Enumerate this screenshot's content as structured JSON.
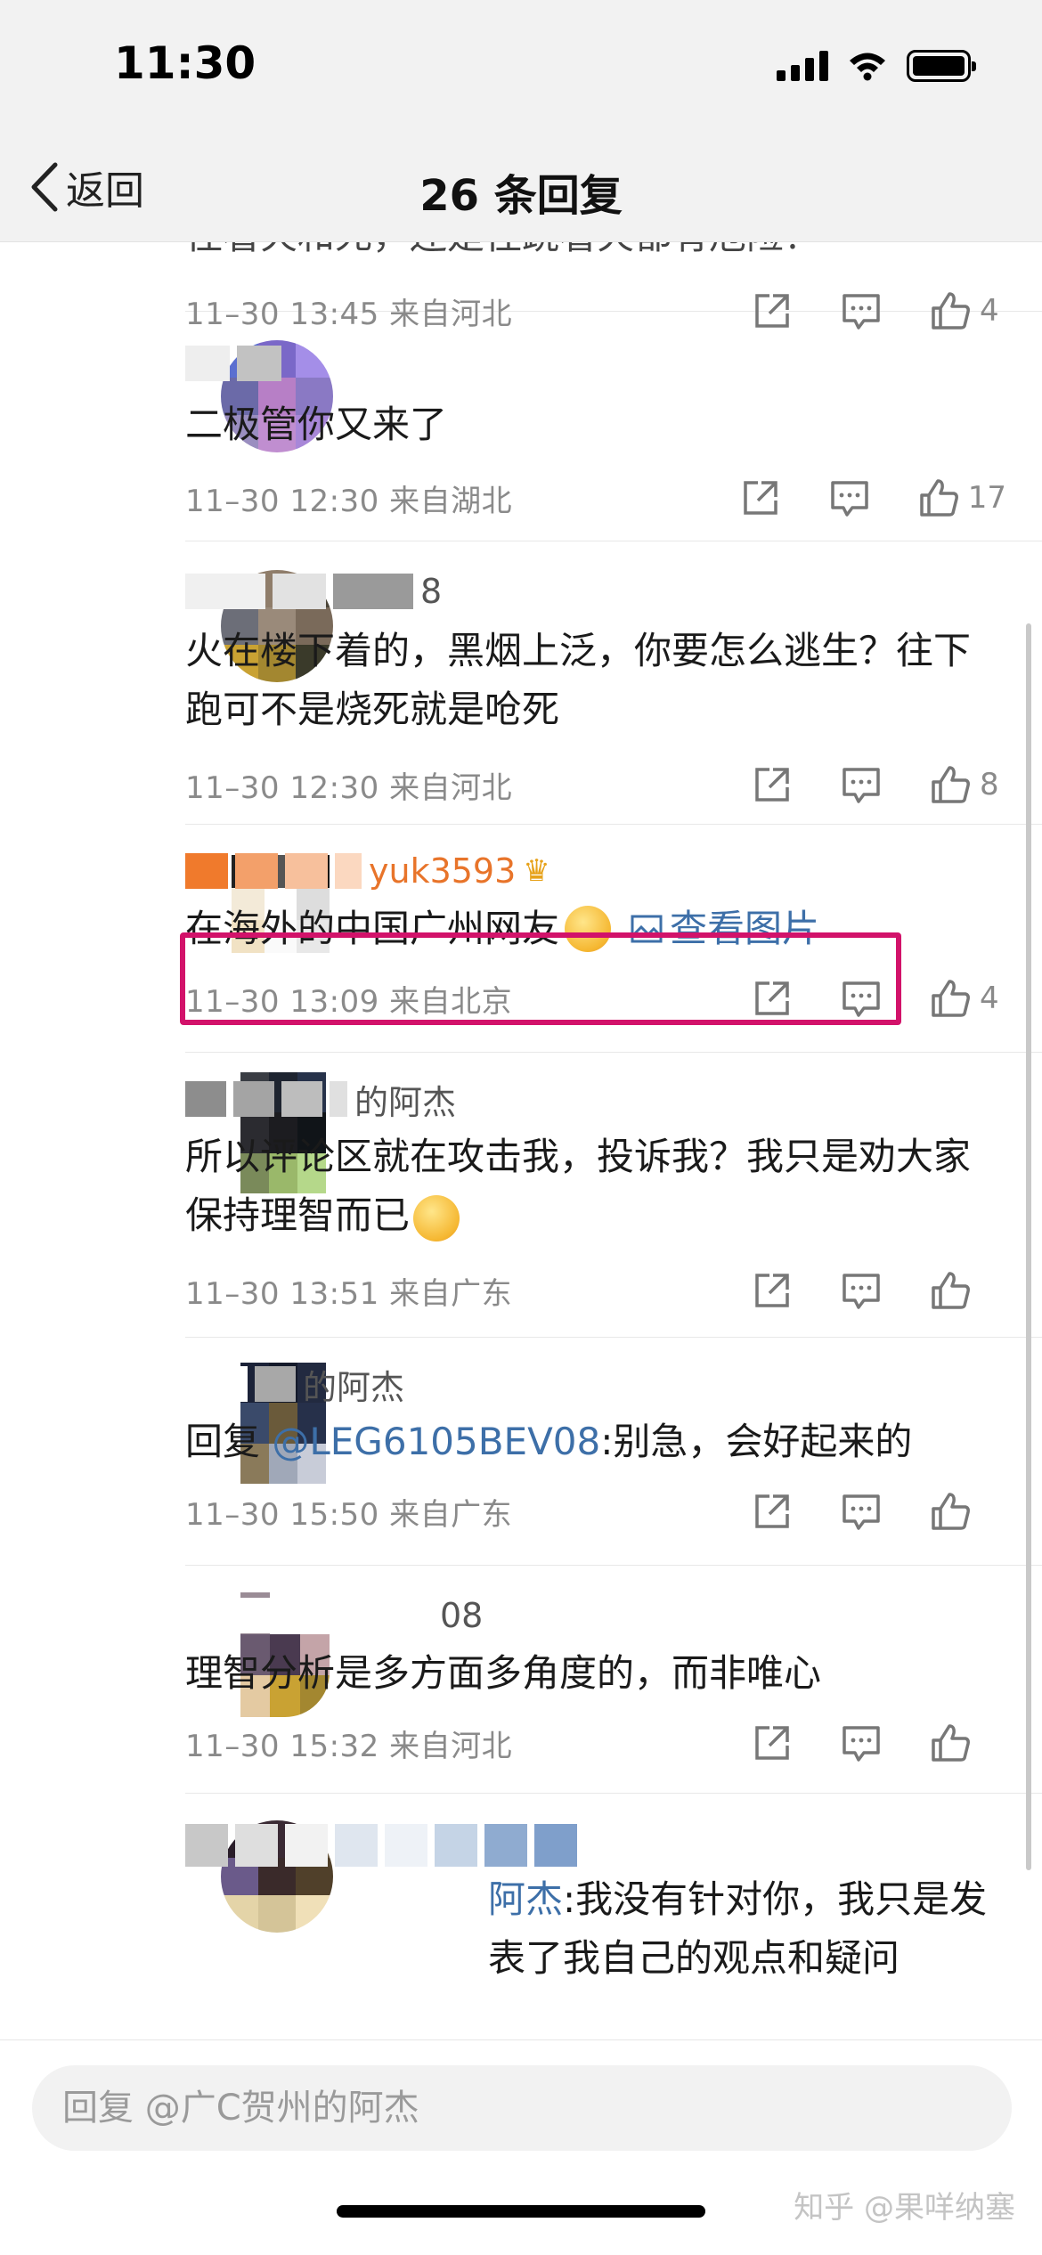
{
  "status_bar": {
    "time": "11:30"
  },
  "nav": {
    "back_label": "返回",
    "title": "26 条回复"
  },
  "replies": [
    {
      "username": "",
      "text": "往看火和死，还是往跳看火都有危险？",
      "meta": "11–30 13:45 来自河北",
      "likes": "4"
    },
    {
      "username": "",
      "text": "二极管你又来了",
      "meta": "11–30 12:30 来自湖北",
      "likes": "17"
    },
    {
      "username": "8",
      "text": "火在楼下着的，黑烟上泛，你要怎么逃生？往下跑可不是烧死就是呛死",
      "meta": "11–30 12:30 来自河北",
      "likes": "8"
    },
    {
      "username": "yuk3593",
      "text": "在海外的中国广州网友",
      "view_image": "查看图片",
      "meta": "11–30 13:09 来自北京",
      "likes": "4"
    },
    {
      "username": "的阿杰",
      "text": "所以评论区就在攻击我，投诉我？我只是劝大家保持理智而已",
      "meta": "11–30 13:51 来自广东",
      "likes": ""
    },
    {
      "username": "的阿杰",
      "reply_prefix": "回复 ",
      "mention": "@LEG6105BEV08",
      "text": ":别急，会好起来的",
      "meta": "11–30 15:50 来自广东",
      "likes": ""
    },
    {
      "username": "08",
      "text": "理智分析是多方面多角度的，而非唯心",
      "meta": "11–30 15:32 来自河北",
      "likes": ""
    },
    {
      "username": "",
      "mention": "阿杰",
      "text": ":我没有针对你，我只是发表了我自己的观点和疑问",
      "meta": "",
      "likes": ""
    }
  ],
  "input": {
    "placeholder": "回复 @广C贺州的阿杰"
  },
  "watermark": "知乎 @果咩纳塞",
  "colors": {
    "accent": "#3d6fa8",
    "highlight": "#d2126a",
    "meta": "#8a8a8a"
  }
}
